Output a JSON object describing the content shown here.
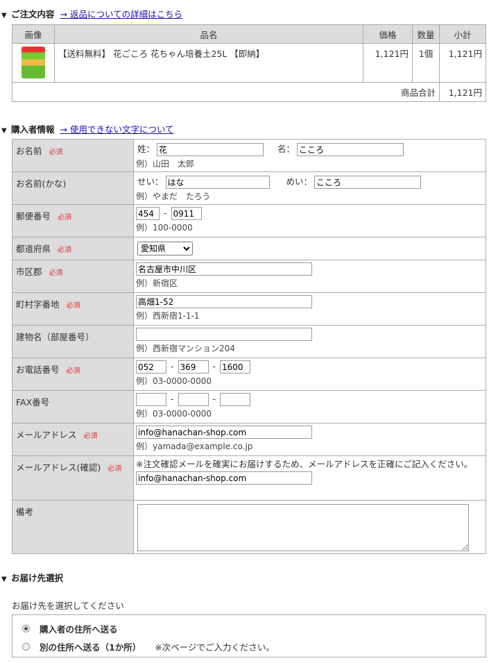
{
  "order": {
    "title": "ご注文内容",
    "link": "→ 返品についての詳細はこちら",
    "headers": [
      "画像",
      "品名",
      "価格",
      "数量",
      "小計"
    ],
    "item": {
      "name": "【送料無料】 花ごころ 花ちゃん培養土25L 【即納】",
      "price": "1,121円",
      "qty": "1個",
      "subtotal": "1,121円"
    },
    "total_label": "商品合計",
    "total_value": "1,121円"
  },
  "buyer": {
    "title": "購入者情報",
    "link": "→ 使用できない文字について",
    "required": "必須",
    "name_label": "お名前",
    "sei": "姓：",
    "sei_val": "花",
    "mei": "名：",
    "mei_val": "こころ",
    "name_ex": "例）山田　太郎",
    "kana_label": "お名前(かな)",
    "sei_k": "せい：",
    "sei_k_val": "はな",
    "mei_k": "めい：",
    "mei_k_val": "こころ",
    "kana_ex": "例）やまだ　たろう",
    "zip_label": "郵便番号",
    "zip1": "454",
    "zip2": "0911",
    "zip_ex": "例）100-0000",
    "pref_label": "都道府県",
    "pref_val": "愛知県",
    "city_label": "市区郡",
    "city_val": "名古屋市中川区",
    "city_ex": "例）新宿区",
    "town_label": "町村字番地",
    "town_val": "高畑1-52",
    "town_ex": "例）西新宿1-1-1",
    "bldg_label": "建物名（部屋番号）",
    "bldg_val": "",
    "bldg_ex": "例）西新宿マンション204",
    "tel_label": "お電話番号",
    "tel1": "052",
    "tel2": "369",
    "tel3": "1600",
    "tel_ex": "例）03-0000-0000",
    "fax_label": "FAX番号",
    "fax_ex": "例）03-0000-0000",
    "mail_label": "メールアドレス",
    "mail_val": "info@hanachan-shop.com",
    "mail_ex": "例）yamada@example.co.jp",
    "mail2_label": "メールアドレス(確認)",
    "mail2_note": "※注文確認メールを確実にお届けするため、メールアドレスを正確にご記入ください。",
    "mail2_val": "info@hanachan-shop.com",
    "memo_label": "備考"
  },
  "ship": {
    "title": "お届け先選択",
    "intro": "お届け先を選択してください",
    "opt1": "購入者の住所へ送る",
    "opt2": "別の住所へ送る（1か所）",
    "opt2_note": "※次ページでご入力ください。"
  },
  "colors": {
    "required": "#dd3333",
    "link": "#1a0dab",
    "header_bg": "#dddddd"
  }
}
